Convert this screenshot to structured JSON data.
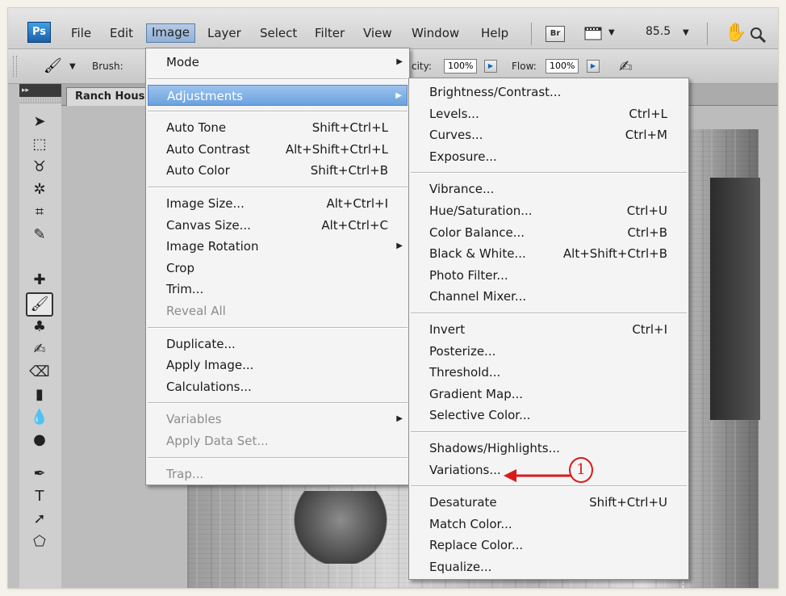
{
  "app": {
    "logo": "Ps"
  },
  "menubar": {
    "items": [
      "File",
      "Edit",
      "Image",
      "Layer",
      "Select",
      "Filter",
      "View",
      "Window",
      "Help"
    ],
    "active": "Image",
    "bridge_label": "Br",
    "zoom": "85.5",
    "icons": [
      "film-icon",
      "hand-icon",
      "zoom-icon"
    ]
  },
  "options": {
    "brush_label": "Brush:",
    "opacity_label": "city:",
    "opacity_value": "100%",
    "flow_label": "Flow:",
    "flow_value": "100%"
  },
  "document": {
    "tab_title": "Ranch Hous"
  },
  "image_menu": [
    {
      "label": "Mode",
      "submenu": true
    },
    {
      "separator": true
    },
    {
      "label": "Adjustments",
      "submenu": true,
      "highlighted": true
    },
    {
      "separator": true
    },
    {
      "label": "Auto Tone",
      "shortcut": "Shift+Ctrl+L"
    },
    {
      "label": "Auto Contrast",
      "shortcut": "Alt+Shift+Ctrl+L"
    },
    {
      "label": "Auto Color",
      "shortcut": "Shift+Ctrl+B"
    },
    {
      "separator": true
    },
    {
      "label": "Image Size...",
      "shortcut": "Alt+Ctrl+I"
    },
    {
      "label": "Canvas Size...",
      "shortcut": "Alt+Ctrl+C"
    },
    {
      "label": "Image Rotation",
      "submenu": true
    },
    {
      "label": "Crop"
    },
    {
      "label": "Trim..."
    },
    {
      "label": "Reveal All",
      "disabled": true
    },
    {
      "separator": true
    },
    {
      "label": "Duplicate..."
    },
    {
      "label": "Apply Image..."
    },
    {
      "label": "Calculations..."
    },
    {
      "separator": true
    },
    {
      "label": "Variables",
      "submenu": true,
      "disabled": true
    },
    {
      "label": "Apply Data Set...",
      "disabled": true
    },
    {
      "separator": true
    },
    {
      "label": "Trap...",
      "disabled": true
    }
  ],
  "adjustments_menu": [
    {
      "label": "Brightness/Contrast..."
    },
    {
      "label": "Levels...",
      "shortcut": "Ctrl+L"
    },
    {
      "label": "Curves...",
      "shortcut": "Ctrl+M"
    },
    {
      "label": "Exposure..."
    },
    {
      "separator": true
    },
    {
      "label": "Vibrance..."
    },
    {
      "label": "Hue/Saturation...",
      "shortcut": "Ctrl+U"
    },
    {
      "label": "Color Balance...",
      "shortcut": "Ctrl+B"
    },
    {
      "label": "Black & White...",
      "shortcut": "Alt+Shift+Ctrl+B"
    },
    {
      "label": "Photo Filter..."
    },
    {
      "label": "Channel Mixer..."
    },
    {
      "separator": true
    },
    {
      "label": "Invert",
      "shortcut": "Ctrl+I"
    },
    {
      "label": "Posterize..."
    },
    {
      "label": "Threshold..."
    },
    {
      "label": "Gradient Map..."
    },
    {
      "label": "Selective Color..."
    },
    {
      "separator": true
    },
    {
      "label": "Shadows/Highlights..."
    },
    {
      "label": "Variations..."
    },
    {
      "separator": true
    },
    {
      "label": "Desaturate",
      "shortcut": "Shift+Ctrl+U"
    },
    {
      "label": "Match Color..."
    },
    {
      "label": "Replace Color..."
    },
    {
      "label": "Equalize..."
    }
  ],
  "annotation": {
    "number": "1",
    "color": "#d91a1a",
    "target": "Variations..."
  },
  "tools": [
    "move-tool",
    "marquee-tool",
    "lasso-tool",
    "magic-wand-tool",
    "crop-tool",
    "eyedropper-tool",
    "healing-brush-tool",
    "brush-tool",
    "clone-stamp-tool",
    "history-brush-tool",
    "eraser-tool",
    "gradient-tool",
    "blur-tool",
    "dodge-tool",
    "pen-tool",
    "type-tool",
    "path-selection-tool",
    "shape-tool"
  ],
  "colors": {
    "highlight": "#6aa2de",
    "menu_bg": "#f0f0f0",
    "disabled_text": "#8c8c8c"
  }
}
